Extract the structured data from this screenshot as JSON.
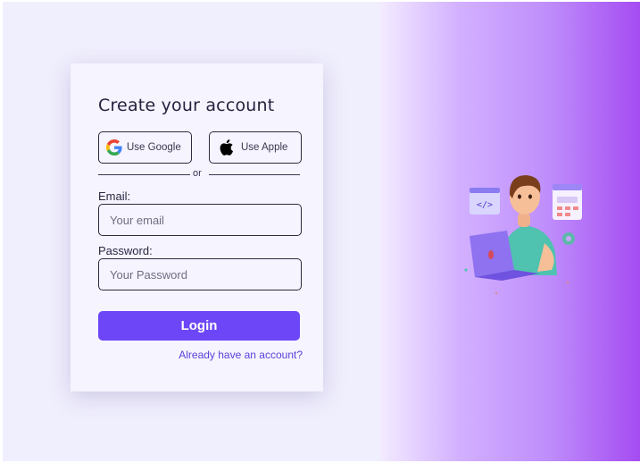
{
  "form": {
    "title": "Create your account",
    "google_label": "Use Google",
    "apple_label": "Use Apple",
    "divider_text": "or",
    "email_label": "Email:",
    "email_placeholder": "Your email",
    "email_value": "",
    "password_label": "Password:",
    "password_placeholder": "Your Password",
    "password_value": "",
    "login_label": "Login",
    "account_link": "Already have an account?"
  },
  "illustration": {
    "code_badge": "</>"
  },
  "colors": {
    "accent": "#6d47f7",
    "link": "#5a3fd8",
    "card_bg": "#f5f4ff",
    "page_bg": "#f0effd",
    "gradient_start": "#f3ebff",
    "gradient_end": "#a54cf1"
  },
  "icons": {
    "google": "google-logo-icon",
    "apple": "apple-logo-icon"
  }
}
